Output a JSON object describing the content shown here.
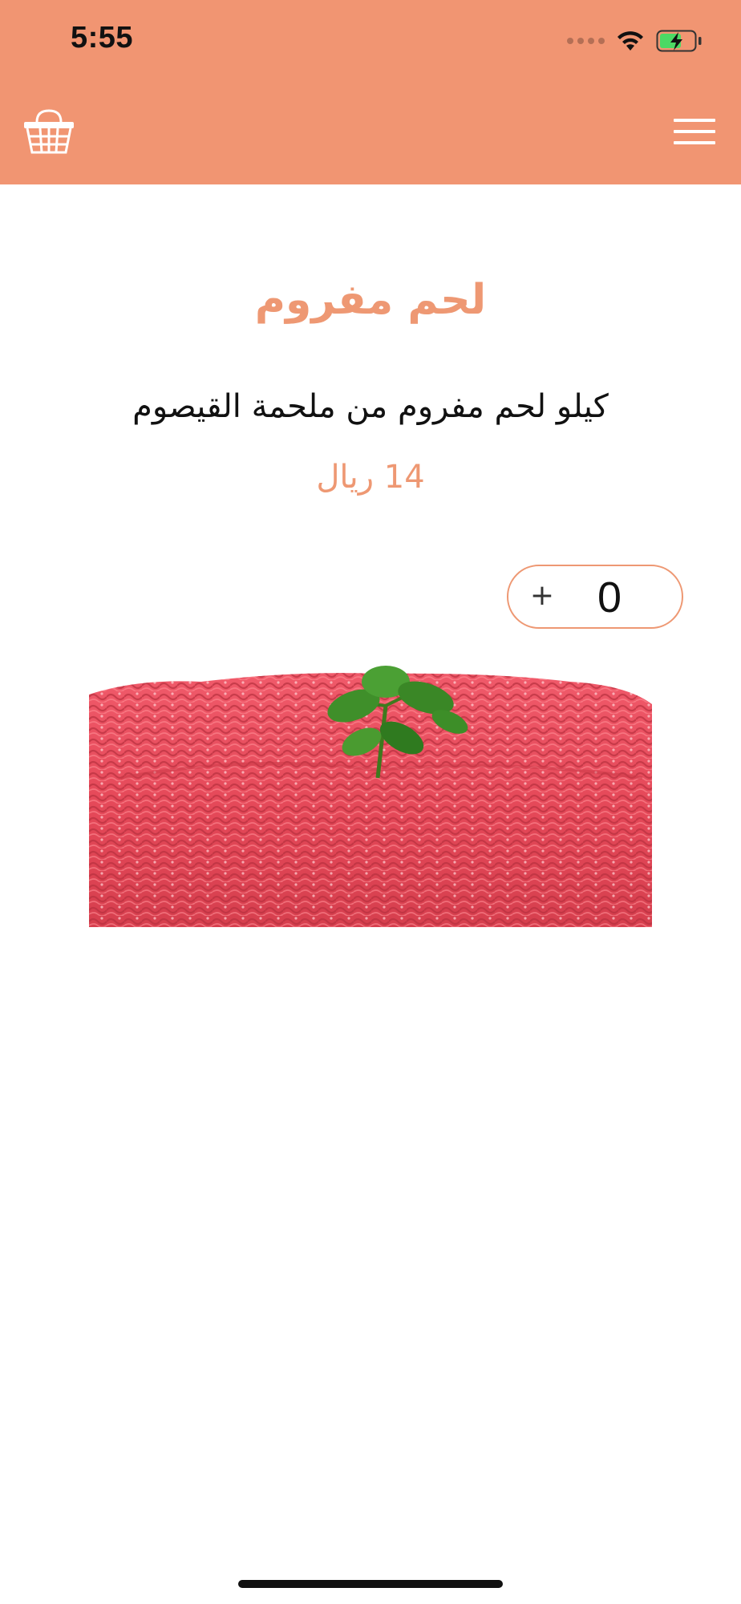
{
  "status_bar": {
    "time": "5:55"
  },
  "header": {
    "background_color": "#F19572",
    "basket_icon": "basket-icon",
    "menu_icon": "hamburger-menu-icon"
  },
  "product": {
    "title": "لحم مفروم",
    "description": "كيلو لحم مفروم من ملحمة القيصوم",
    "price": "14 ريال",
    "accent_color": "#EE9873"
  },
  "quantity": {
    "plus_label": "+",
    "value": "0"
  }
}
